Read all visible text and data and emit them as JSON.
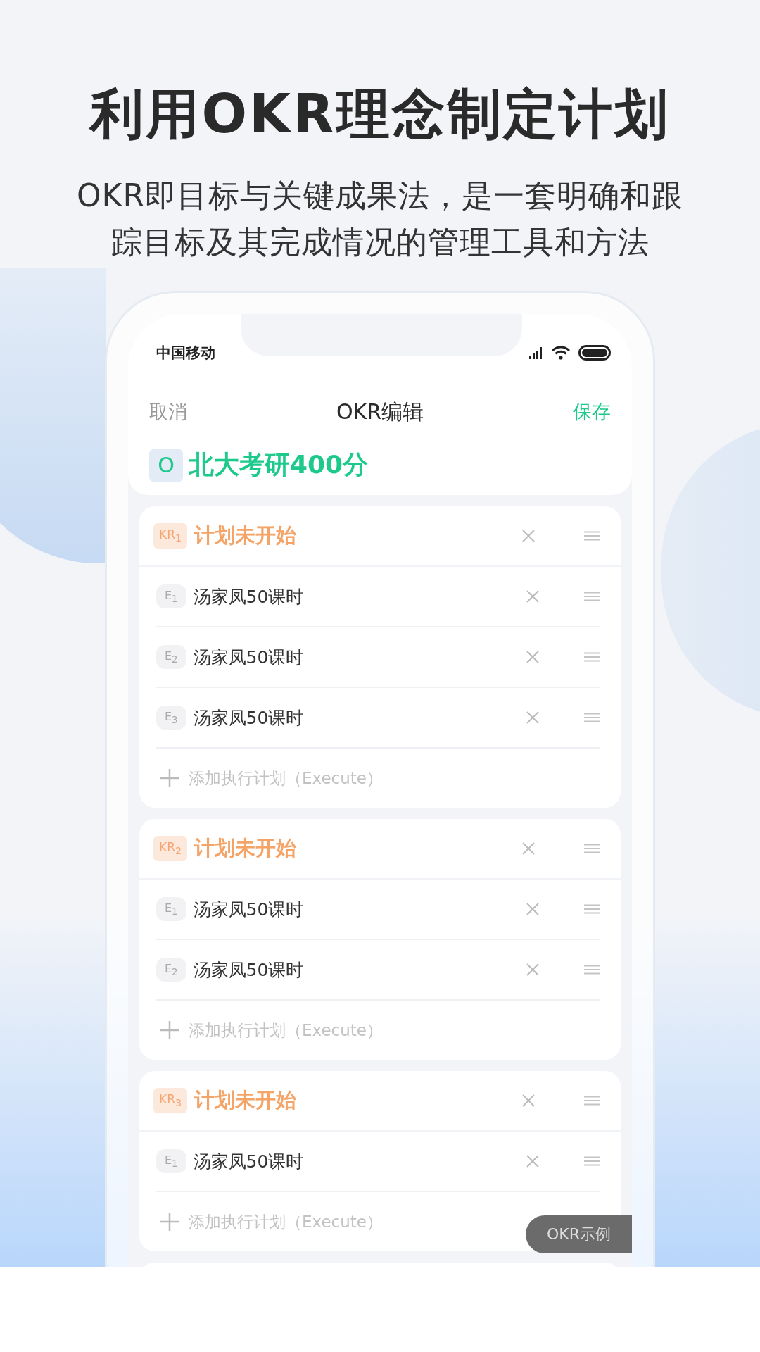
{
  "headline": "利用OKR理念制定计划",
  "subtitle": [
    "OKR即目标与关键成果法，是一套明确和跟",
    "踪目标及其完成情况的管理工具和方法"
  ],
  "status_bar": {
    "carrier": "中国移动"
  },
  "nav": {
    "cancel": "取消",
    "title": "OKR编辑",
    "save": "保存"
  },
  "objective": {
    "tag": "O",
    "title": "北大考研400分"
  },
  "key_results": [
    {
      "tag": "KR$_{1}$",
      "title": "计划未开始",
      "executes": [
        {
          "tag": "E$_{1}$",
          "text": "汤家凤50课时"
        },
        {
          "tag": "E$_{2}$",
          "text": "汤家凤50课时"
        },
        {
          "tag": "E$_{3}$",
          "text": "汤家凤50课时"
        }
      ],
      "add_label": "添加执行计划（Execute）"
    },
    {
      "tag": "KR$_{2}$",
      "title": "计划未开始",
      "executes": [
        {
          "tag": "E$_{1}$",
          "text": "汤家凤50课时"
        },
        {
          "tag": "E$_{2}$",
          "text": "汤家凤50课时"
        }
      ],
      "add_label": "添加执行计划（Execute）"
    },
    {
      "tag": "KR$_{3}$",
      "title": "计划未开始",
      "executes": [
        {
          "tag": "E$_{1}$",
          "text": "汤家凤50课时"
        }
      ],
      "add_label": "添加执行计划（Execute）"
    }
  ],
  "floating_button": "OKR示例"
}
